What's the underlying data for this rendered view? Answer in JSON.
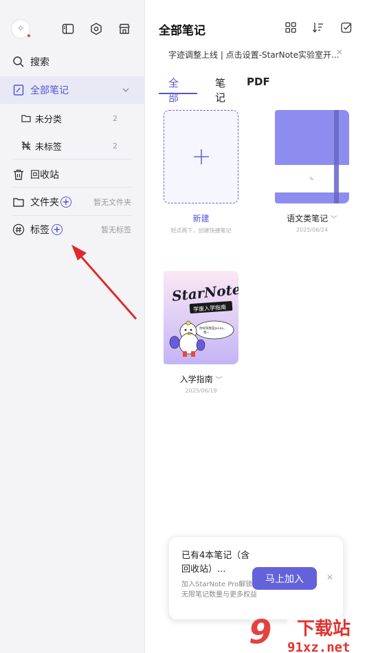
{
  "sidebar": {
    "search_label": "搜索",
    "all_notes_label": "全部笔记",
    "uncategorized_label": "未分类",
    "uncategorized_count": "2",
    "untagged_label": "未标签",
    "untagged_count": "2",
    "recycle_label": "回收站",
    "folder_label": "文件夹",
    "folder_hint": "暂无文件夹",
    "tag_label": "标签",
    "tag_hint": "暂无标签"
  },
  "main": {
    "title": "全部笔记",
    "banner": "字迹调整上线 | 点击设置-StarNote实验室开...",
    "tabs": [
      "全部",
      "笔记",
      "PDF"
    ],
    "new_note": {
      "name": "新建",
      "hint": "轻点两下，创建快捷笔记"
    },
    "notebooks": [
      {
        "name": "语文类笔记",
        "date": "2025/06/24"
      },
      {
        "name": "入学指南",
        "date": "2025/06/19"
      }
    ],
    "guide_cover": {
      "title": "StarNote",
      "subtitle": "学废入学指南",
      "bubble": "你好呀我是Jenna，我~"
    }
  },
  "promo": {
    "title": "已有4本笔记（含回收站）...",
    "desc": "加入StarNote Pro解锁无限笔记数量与更多权益",
    "button": "马上加入"
  },
  "watermark": {
    "text": "下载站",
    "url": "91xz.net"
  },
  "colors": {
    "accent": "#5553d6",
    "sidebar_bg": "#f4f4f7",
    "arrow": "#e02a2a",
    "book": "#8d8df0"
  }
}
